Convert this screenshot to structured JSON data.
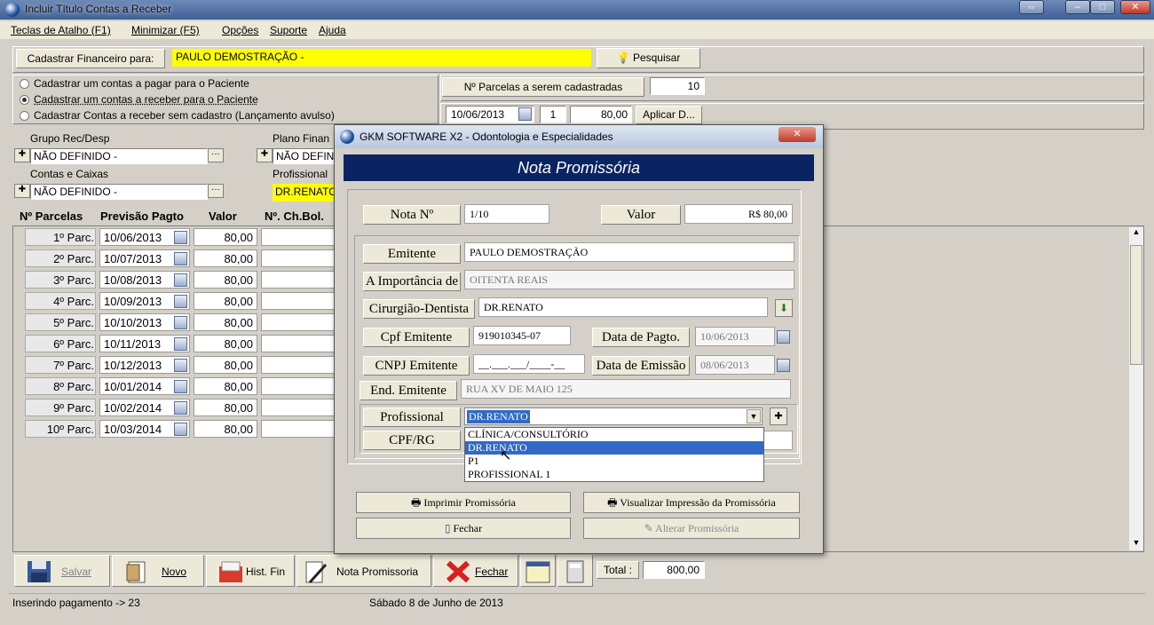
{
  "window": {
    "title": "Incluir Título Contas a Receber"
  },
  "menu": [
    "Teclas de Atalho (F1)",
    "Minimizar (F5)",
    "Opções",
    "Suporte",
    "Ajuda"
  ],
  "header": {
    "label": "Cadastrar Financeiro para:",
    "patient": "PAULO DEMOSTRAÇÃO -",
    "search_button": "Pesquisar"
  },
  "options": {
    "items": [
      "Cadastrar um contas a pagar para o Paciente",
      "Cadastrar um contas a receber para o Paciente",
      "Cadastrar Contas a receber sem cadastro (Lançamento avulso)"
    ],
    "selected_index": 1
  },
  "parcelas_count": {
    "label": "Nº Parcelas a serem cadastradas",
    "value": "10"
  },
  "apply_row": {
    "date": "10/06/2013",
    "num": "1",
    "value": "80,00",
    "apply_button": "Aplicar D..."
  },
  "fields": {
    "grupo_label": "Grupo Rec/Desp",
    "grupo_value": "NÃO DEFINIDO -",
    "plano_label": "Plano Finan",
    "plano_value": "NÃO DEFIN",
    "contas_label": "Contas e Caixas",
    "contas_value": "NÃO DEFINIDO -",
    "prof_label": "Profissional",
    "prof_value": "DR.RENATO"
  },
  "table": {
    "headers": [
      "Nº Parcelas",
      "Previsão Pagto",
      "Valor",
      "Nº. Ch.Bol."
    ],
    "rows": [
      {
        "parc": "1º Parc.",
        "date": "10/06/2013",
        "value": "80,00"
      },
      {
        "parc": "2º Parc.",
        "date": "10/07/2013",
        "value": "80,00"
      },
      {
        "parc": "3º Parc.",
        "date": "10/08/2013",
        "value": "80,00"
      },
      {
        "parc": "4º Parc.",
        "date": "10/09/2013",
        "value": "80,00"
      },
      {
        "parc": "5º Parc.",
        "date": "10/10/2013",
        "value": "80,00"
      },
      {
        "parc": "6º Parc.",
        "date": "10/11/2013",
        "value": "80,00"
      },
      {
        "parc": "7º Parc.",
        "date": "10/12/2013",
        "value": "80,00"
      },
      {
        "parc": "8º Parc.",
        "date": "10/01/2014",
        "value": "80,00"
      },
      {
        "parc": "9º Parc.",
        "date": "10/02/2014",
        "value": "80,00"
      },
      {
        "parc": "10º Parc.",
        "date": "10/03/2014",
        "value": "80,00"
      }
    ]
  },
  "toolbar": {
    "salvar": "Salvar",
    "novo": "Novo",
    "hist": "Hist. Fin",
    "nota": "Nota Promissoria",
    "fechar": "Fechar",
    "total_label": "Total :",
    "total_value": "800,00"
  },
  "status": {
    "left": "Inserindo pagamento -> 23",
    "date": "Sábado 8 de Junho de  2013"
  },
  "modal": {
    "title": "GKM SOFTWARE X2 - Odontologia e Especialidades",
    "banner": "Nota Promissória",
    "nota_label": "Nota Nº",
    "nota_value": "1/10",
    "valor_label": "Valor",
    "valor_value": "R$ 80,00",
    "emitente_label": "Emitente",
    "emitente_value": "PAULO DEMOSTRAÇÃO",
    "importancia_label": "A Importância de",
    "importancia_value": "OITENTA REAIS",
    "cirurgiao_label": "Cirurgião-Dentista",
    "cirurgiao_value": "DR.RENATO",
    "cpf_label": "Cpf Emitente",
    "cpf_value": "919010345-07",
    "data_pagto_label": "Data de Pagto.",
    "data_pagto_value": "10/06/2013",
    "cnpj_label": "CNPJ Emitente",
    "cnpj_value": "__.___.___/____-__",
    "data_emissao_label": "Data de Emissão",
    "data_emissao_value": "08/06/2013",
    "end_label": "End. Emitente",
    "end_value": "RUA XV DE MAIO 125",
    "profissional_label": "Profissional",
    "profissional_value": "DR.RENATO",
    "cpfrg_label": "CPF/RG",
    "dropdown": [
      "CLÍNICA/CONSULTÓRIO",
      "DR.RENATO",
      "P1",
      "PROFISSIONAL 1"
    ],
    "dropdown_selected": 1,
    "btn_imprimir": "Imprimir Promissória",
    "btn_visualizar": "Visualizar Impressão da Promissória",
    "btn_fechar": "Fechar",
    "btn_alterar": "Alterar Promissória"
  }
}
